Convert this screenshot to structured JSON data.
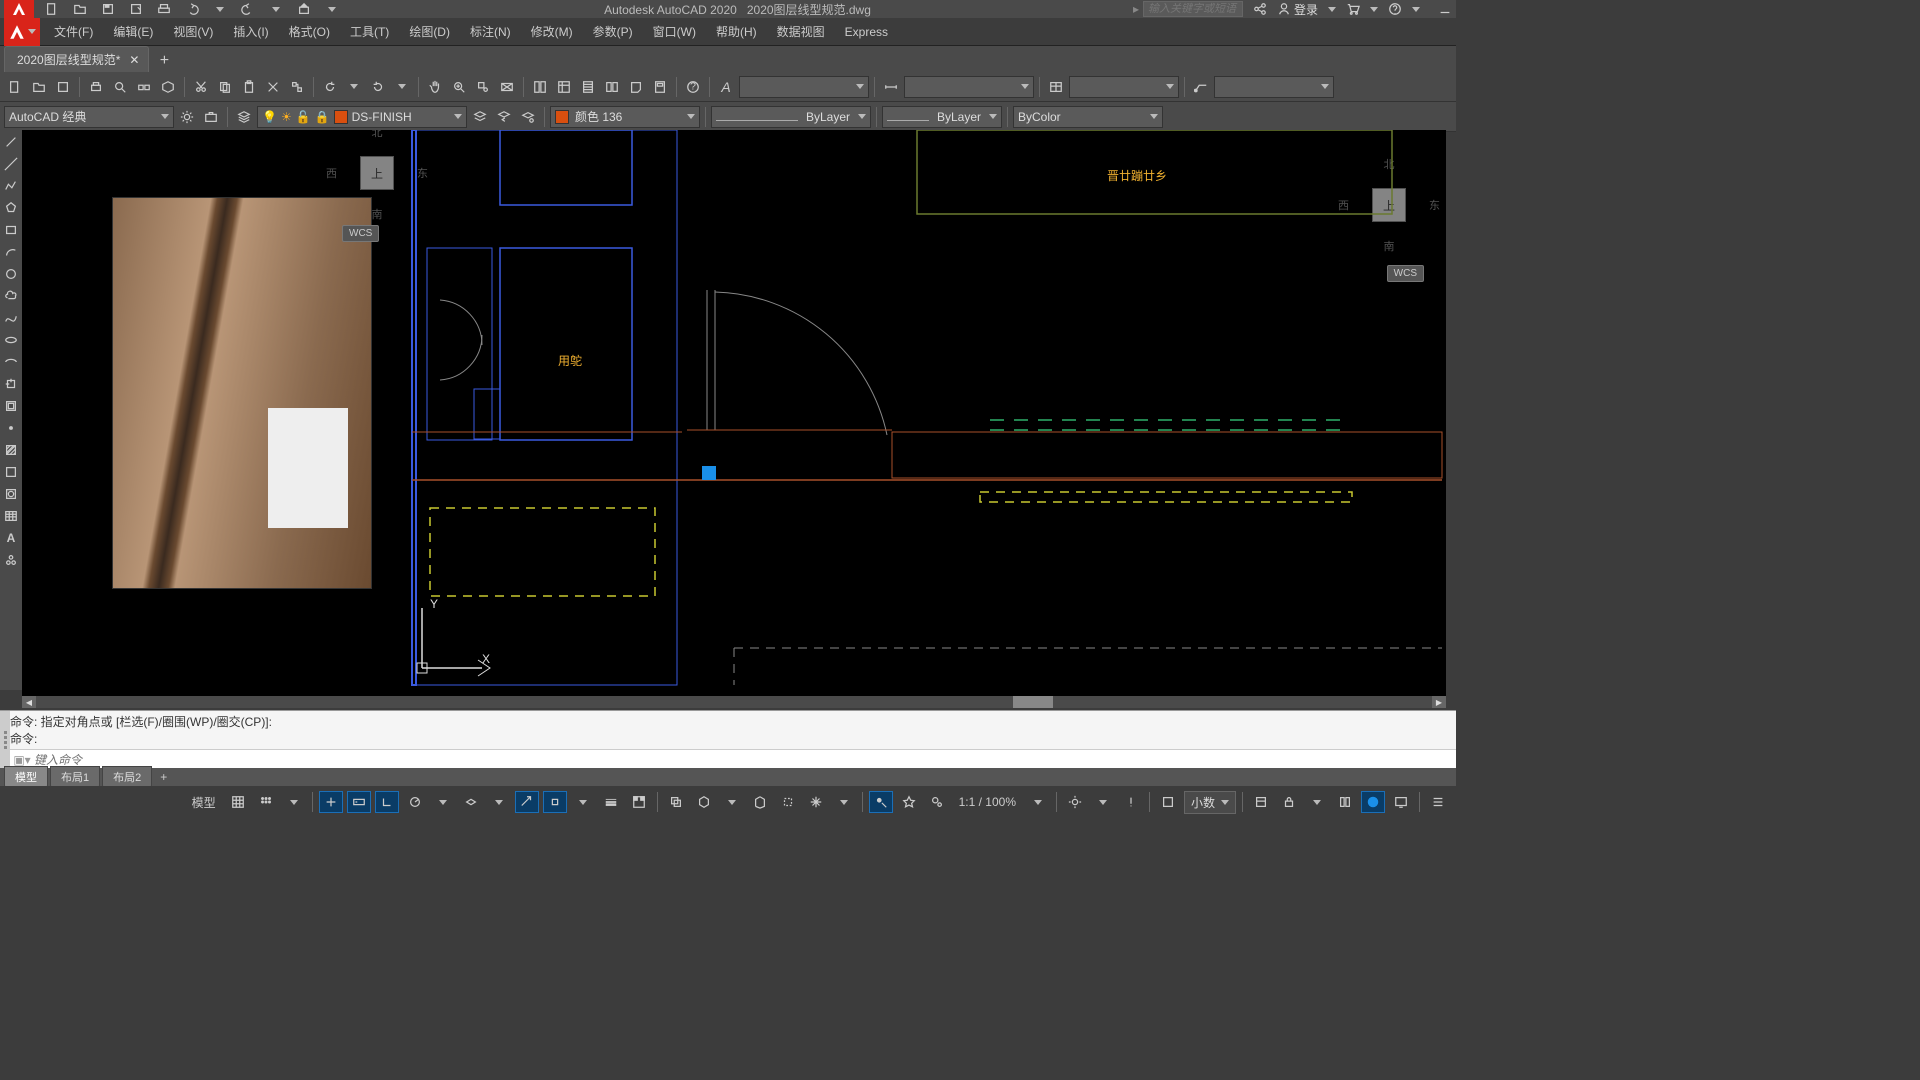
{
  "title": {
    "app": "Autodesk AutoCAD 2020",
    "file": "2020图层线型规范.dwg",
    "search_placeholder": "输入关键字或短语",
    "login": "登录"
  },
  "menu": {
    "file": "文件(F)",
    "edit": "编辑(E)",
    "view": "视图(V)",
    "insert": "插入(I)",
    "format": "格式(O)",
    "tool": "工具(T)",
    "draw": "绘图(D)",
    "dim": "标注(N)",
    "modify": "修改(M)",
    "param": "参数(P)",
    "window": "窗口(W)",
    "help": "帮助(H)",
    "dataview": "数据视图",
    "express": "Express"
  },
  "filetab": {
    "name": "2020图层线型规范*"
  },
  "workspace": {
    "name": "AutoCAD 经典"
  },
  "layer": {
    "name": "DS-FINISH",
    "color_name": "颜色 136",
    "lw": "ByLayer",
    "lt": "ByLayer",
    "plot": "ByColor"
  },
  "canvas_text": {
    "room": "用鸵",
    "title": "晋廿蹦廿乡"
  },
  "viewcube": {
    "n": "北",
    "s": "南",
    "e": "东",
    "w": "西",
    "top": "上",
    "wcs": "WCS"
  },
  "ucs": {
    "x": "X",
    "y": "Y"
  },
  "cmd": {
    "line1": "命令: 指定对角点或 [栏选(F)/圈围(WP)/圈交(CP)]:",
    "line2": "命令:",
    "placeholder": "键入命令"
  },
  "layouts": {
    "model": "模型",
    "l1": "布局1",
    "l2": "布局2"
  },
  "status": {
    "model": "模型",
    "zoom": "1:1 / 100%",
    "dec": "小数"
  }
}
